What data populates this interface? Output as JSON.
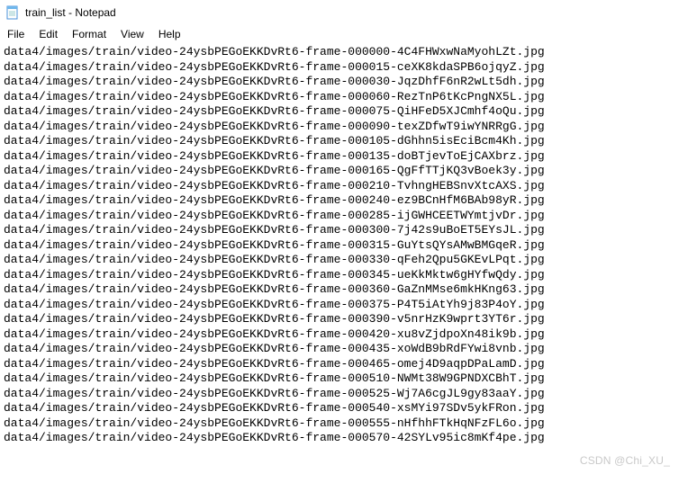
{
  "window": {
    "title": "train_list - Notepad",
    "icon": "notepad-icon"
  },
  "menu": {
    "file": "File",
    "edit": "Edit",
    "format": "Format",
    "view": "View",
    "help": "Help"
  },
  "lines": [
    "data4/images/train/video-24ysbPEGoEKKDvRt6-frame-000000-4C4FHWxwNaMyohLZt.jpg",
    "data4/images/train/video-24ysbPEGoEKKDvRt6-frame-000015-ceXK8kdaSPB6ojqyZ.jpg",
    "data4/images/train/video-24ysbPEGoEKKDvRt6-frame-000030-JqzDhfF6nR2wLt5dh.jpg",
    "data4/images/train/video-24ysbPEGoEKKDvRt6-frame-000060-RezTnP6tKcPngNX5L.jpg",
    "data4/images/train/video-24ysbPEGoEKKDvRt6-frame-000075-QiHFeD5XJCmhf4oQu.jpg",
    "data4/images/train/video-24ysbPEGoEKKDvRt6-frame-000090-texZDfwT9iwYNRRgG.jpg",
    "data4/images/train/video-24ysbPEGoEKKDvRt6-frame-000105-dGhhn5isEciBcm4Kh.jpg",
    "data4/images/train/video-24ysbPEGoEKKDvRt6-frame-000135-doBTjevToEjCAXbrz.jpg",
    "data4/images/train/video-24ysbPEGoEKKDvRt6-frame-000165-QgFfTTjKQ3vBoek3y.jpg",
    "data4/images/train/video-24ysbPEGoEKKDvRt6-frame-000210-TvhngHEBSnvXtcAXS.jpg",
    "data4/images/train/video-24ysbPEGoEKKDvRt6-frame-000240-ez9BCnHfM6BAb98yR.jpg",
    "data4/images/train/video-24ysbPEGoEKKDvRt6-frame-000285-ijGWHCEETWYmtjvDr.jpg",
    "data4/images/train/video-24ysbPEGoEKKDvRt6-frame-000300-7j42s9uBoET5EYsJL.jpg",
    "data4/images/train/video-24ysbPEGoEKKDvRt6-frame-000315-GuYtsQYsAMwBMGqeR.jpg",
    "data4/images/train/video-24ysbPEGoEKKDvRt6-frame-000330-qFeh2Qpu5GKEvLPqt.jpg",
    "data4/images/train/video-24ysbPEGoEKKDvRt6-frame-000345-ueKkMktw6gHYfwQdy.jpg",
    "data4/images/train/video-24ysbPEGoEKKDvRt6-frame-000360-GaZnMMse6mkHKng63.jpg",
    "data4/images/train/video-24ysbPEGoEKKDvRt6-frame-000375-P4T5iAtYh9j83P4oY.jpg",
    "data4/images/train/video-24ysbPEGoEKKDvRt6-frame-000390-v5nrHzK9wprt3YT6r.jpg",
    "data4/images/train/video-24ysbPEGoEKKDvRt6-frame-000420-xu8vZjdpoXn48ik9b.jpg",
    "data4/images/train/video-24ysbPEGoEKKDvRt6-frame-000435-xoWdB9bRdFYwi8vnb.jpg",
    "data4/images/train/video-24ysbPEGoEKKDvRt6-frame-000465-omej4D9aqpDPaLamD.jpg",
    "data4/images/train/video-24ysbPEGoEKKDvRt6-frame-000510-NWMt38W9GPNDXCBhT.jpg",
    "data4/images/train/video-24ysbPEGoEKKDvRt6-frame-000525-Wj7A6cgJL9gy83aaY.jpg",
    "data4/images/train/video-24ysbPEGoEKKDvRt6-frame-000540-xsMYi97SDv5ykFRon.jpg",
    "data4/images/train/video-24ysbPEGoEKKDvRt6-frame-000555-nHfhhFTkHqNFzFL6o.jpg",
    "data4/images/train/video-24ysbPEGoEKKDvRt6-frame-000570-42SYLv95ic8mKf4pe.jpg"
  ],
  "watermark": "CSDN @Chi_XU_"
}
